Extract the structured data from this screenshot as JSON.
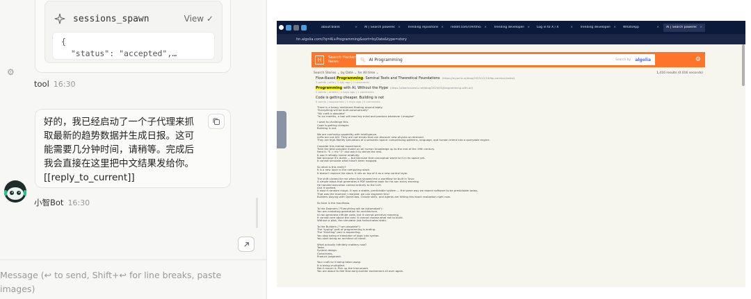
{
  "chat": {
    "tool_card": {
      "name": "sessions_spawn",
      "view_label": "View ✓",
      "json_preview": "{\n  \"status\": \"accepted\",…"
    },
    "tool_label": "tool",
    "tool_time": "16:30",
    "assistant_message": "好的，我已经启动了一个子代理来抓取最新的趋势数据并生成日报。这可能需要几分钟时间，请稍等。完成后我会直接在这里把中文结果发给你。",
    "assistant_tag": "[[reply_to_current]]",
    "bot_name": "小智Bot",
    "bot_time": "16:30",
    "composer_placeholder": "Message (↩ to send, Shift+↩ for line breaks, paste images)"
  },
  "browser": {
    "tabs": [
      {
        "label": "about:blank",
        "active": false
      },
      {
        "label": "AI | Search powered",
        "active": false
      },
      {
        "label": "Trending repositories",
        "active": false
      },
      {
        "label": "reddit.com/r/ArtificialI",
        "active": false
      },
      {
        "label": "Trending developers",
        "active": false
      },
      {
        "label": "Log in to X / X",
        "active": false
      },
      {
        "label": "Trending developers",
        "active": false
      },
      {
        "label": "WhatsApp",
        "active": false
      },
      {
        "label": "AI | Search powered",
        "active": true
      }
    ],
    "url": "hn.algolia.com/?q=AI+Programming&sort=byDate&type=story",
    "hn": {
      "logo": "H",
      "title": "Search Hacker News",
      "query": "AI Programming",
      "search_by": "Search by",
      "algolia": "algolia",
      "filters": {
        "search": "Search",
        "stories": "Stories ⌄",
        "by": "by",
        "date": "Date ⌄",
        "for": "for",
        "alltime": "All time ⌄",
        "results": "1,416 results (0.016 seconds)"
      },
      "results": [
        {
          "title_pre": "Flow-Based ",
          "title_hl": "Programming",
          "title_post": ": Seminal Texts and Theoretical Foundations",
          "url": "(https://mypmic.ai/blog/2025/12/10/fbp-seminal-texts/)",
          "meta": "3 points | alfie | 1 day ago | 0 comments"
        },
        {
          "title_pre": "",
          "title_hl": "Programming",
          "title_post": " with AI, Without the Hype",
          "url": "(https://albertcavestu.net/blog/2025/02/programming-with-ai/)",
          "meta": "2 points | aldeen | 4 days ago | 1 comments"
        },
        {
          "title_pre": "Code is getting cheaper. Building is not",
          "title_hl": "",
          "title_post": "",
          "url": "",
          "meta": "8 points | sospaaristo | 5 days ago | 0 comments"
        }
      ],
      "body": "There is a heavy sentiment floating around lately.\n\"Everything will be built automatically\"\n\"My craft is obsolete\"\n\"In six months, a tool will read my mind and produce whatever I imagine\"\n\nI want to challenge this.\nCode is getting cheaper.\nBuilding is not.\n\nWe are confusing capability with intelligence.\nLLMs are not AGI. They are not minds that can discover new physics on demand.\nThey are high-fidelity simulators of a semantic space: compressing patterns, language, and human intent into a queryable engine.\n\nConsider this mental experiment:\nTrain the best possible model on all human knowledge up to the end of the 19th century.\nFeed it: \"E = mc^2\" and ask it to derive the rest.\nIt won't reliably invent relativity.\nNot because it's dumb — but because that conceptual world isn't in its space yet.\nIt cannot simulate what hasn't been mapped.\n\nSo what is this really?\nIt is a new layer in the computing stack.\nIt doesn't replace the stack. It sits on top of it as a new control layer.\n\nThe shift clicked for me when Ilya showed me a workflow he built in Tuvo:\nA simple steps that generates a PDF bedtime book for his son every evening.\nHe handed execution control entirely to the LLM.\nAnd it worked.\nIt wasn't random magic. It was a stable, predictable system — the same way we expect software to be predictable today.\nThat was the moment I realized: we can engineer this!\nBuilders playing with OpenClaw, Claude skills, and agents are hitting this exact realization right now.\n\nSo here is the manifesto.\n\nTo the Doomers (\"Everything will be automated\"):\nYou are mistaking generation for architecture.\nAI can generate infinite code, but it cannot perceive meaning.\nIt cannot care about the user. It cannot choose what not to build.\nWithout a pilot, the simulator just hallucinates static.\n\nTo the Builders (\"I am obsolete\"):\nThe \"typing\" part of programming is ending.\nThe \"thinking\" part is expanding.\nYou stop being a translator of logic into syntax.\nYou start being an architect of intent.\n\nWhat actually infinitely matters now?\nTaste.\nSystem design.\nConstraints.\nProduct judgment.\n\nYour craft isn't being taken away.\nIt is being multiplied.\nDon't mourn it. Pick up the instrument.\nYou are about to feel that early-builder excitement all over again."
    }
  },
  "colors": {
    "hn_orange": "#ff742b",
    "tab_bar": "#0b1a3a",
    "highlight": "#ffff00"
  }
}
